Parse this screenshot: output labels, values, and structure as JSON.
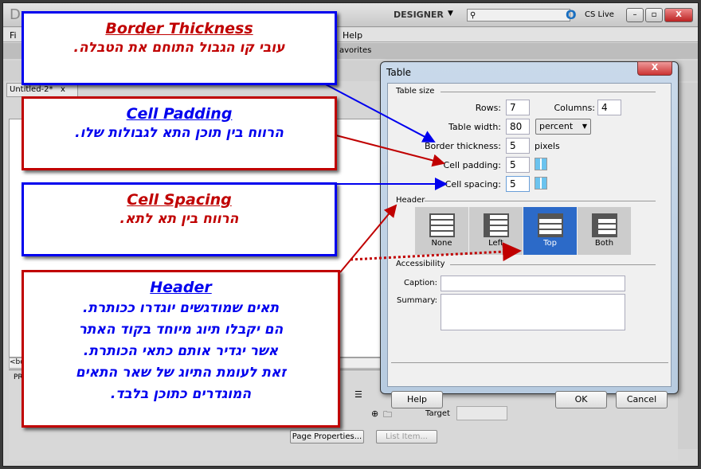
{
  "app": {
    "logo": "Dw",
    "workspace": "DESIGNER",
    "search_placeholder": "",
    "cs_live": "CS Live",
    "menu_first": "Fi",
    "menu_help": "Help",
    "insert_tab_favorites": "avorites",
    "doc_tab": "Untitled-2*",
    "doc_tab_close": "x",
    "tag_selector": "<bo",
    "props_label": "PR",
    "target_label": "Target",
    "page_properties": "Page Properties...",
    "list_item": "List Item..."
  },
  "dialog": {
    "title": "Table",
    "close": "X",
    "table_size_label": "Table size",
    "rows_label": "Rows:",
    "rows": "7",
    "columns_label": "Columns:",
    "columns": "4",
    "width_label": "Table width:",
    "width": "80",
    "width_unit": "percent",
    "border_label": "Border thickness:",
    "border": "5",
    "border_unit": "pixels",
    "padding_label": "Cell padding:",
    "padding": "5",
    "spacing_label": "Cell spacing:",
    "spacing": "5",
    "header_label": "Header",
    "header_options": [
      "None",
      "Left",
      "Top",
      "Both"
    ],
    "header_selected": "Top",
    "accessibility_label": "Accessibility",
    "caption_label": "Caption:",
    "caption": "",
    "summary_label": "Summary:",
    "summary": "",
    "help": "Help",
    "ok": "OK",
    "cancel": "Cancel"
  },
  "callouts": {
    "border": {
      "title": "Border Thickness",
      "text": "עובי קו הגבול התוחם את הטבלה."
    },
    "padding": {
      "title": "Cell Padding",
      "text": "הרווח בין תוכן התא לגבולות שלו."
    },
    "spacing": {
      "title": "Cell Spacing",
      "text": "הרווח בין תא לתא."
    },
    "header": {
      "title": "Header",
      "lines": [
        "תאים שמודגשים יוגדרו ככותרת.",
        "הם יקבלו תיוג מיוחד בקוד האתר",
        "אשר יגדיר אותם כתאי הכותרת.",
        "זאת לעומת התיוג של שאר התאים",
        "המוגדרים כתוכן בלבד."
      ]
    }
  },
  "colors": {
    "callout_red": "#c00000",
    "callout_blue": "#0000ee",
    "selected": "#2c6ac8"
  }
}
